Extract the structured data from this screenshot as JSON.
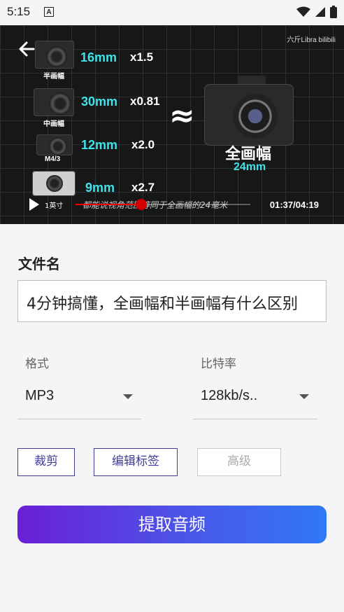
{
  "status_bar": {
    "time": "5:15",
    "notification_glyph": "A"
  },
  "video": {
    "watermark": "六斤Libra bilibili",
    "cameras": [
      {
        "label": "半画幅",
        "focal": "16mm",
        "multiplier": "x1.5"
      },
      {
        "label": "中画幅",
        "focal": "30mm",
        "multiplier": "x0.81"
      },
      {
        "label": "M4/3",
        "focal": "12mm",
        "multiplier": "x2.0"
      },
      {
        "label": "1英寸",
        "focal": "9mm",
        "multiplier": "x2.7"
      }
    ],
    "approx_symbol": "≈",
    "full_frame_label": "全画幅",
    "full_frame_focal": "24mm",
    "subtitle": "都能说视角范围等同于全画幅的24毫米",
    "time_readout": "01:37/04:19",
    "progress": 0.374
  },
  "form": {
    "filename_title": "文件名",
    "filename_value": "4分钟搞懂，全画幅和半画幅有什么区别",
    "format_label": "格式",
    "format_value": "MP3",
    "bitrate_label": "比特率",
    "bitrate_value": "128kb/s..",
    "buttons": {
      "trim": "裁剪",
      "edit_tags": "编辑标签",
      "advanced": "高级"
    },
    "extract_button": "提取音频"
  }
}
